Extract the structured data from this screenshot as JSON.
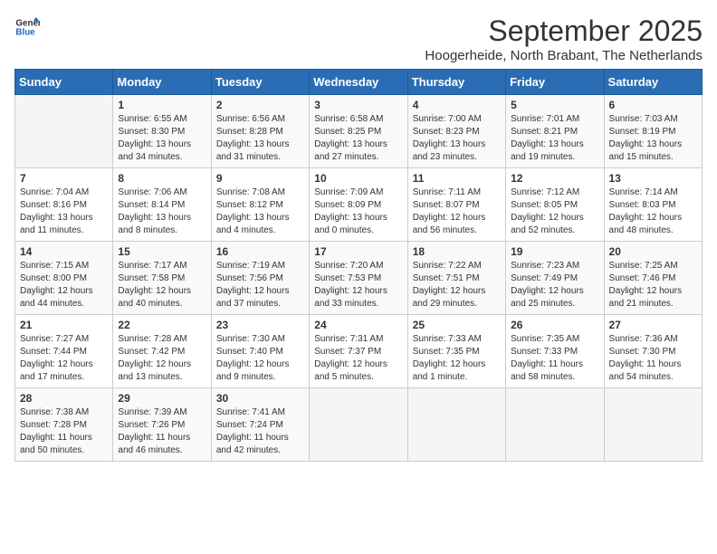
{
  "header": {
    "logo_general": "General",
    "logo_blue": "Blue",
    "month_title": "September 2025",
    "location": "Hoogerheide, North Brabant, The Netherlands"
  },
  "days_of_week": [
    "Sunday",
    "Monday",
    "Tuesday",
    "Wednesday",
    "Thursday",
    "Friday",
    "Saturday"
  ],
  "weeks": [
    [
      {
        "day": "",
        "info": ""
      },
      {
        "day": "1",
        "info": "Sunrise: 6:55 AM\nSunset: 8:30 PM\nDaylight: 13 hours and 34 minutes."
      },
      {
        "day": "2",
        "info": "Sunrise: 6:56 AM\nSunset: 8:28 PM\nDaylight: 13 hours and 31 minutes."
      },
      {
        "day": "3",
        "info": "Sunrise: 6:58 AM\nSunset: 8:25 PM\nDaylight: 13 hours and 27 minutes."
      },
      {
        "day": "4",
        "info": "Sunrise: 7:00 AM\nSunset: 8:23 PM\nDaylight: 13 hours and 23 minutes."
      },
      {
        "day": "5",
        "info": "Sunrise: 7:01 AM\nSunset: 8:21 PM\nDaylight: 13 hours and 19 minutes."
      },
      {
        "day": "6",
        "info": "Sunrise: 7:03 AM\nSunset: 8:19 PM\nDaylight: 13 hours and 15 minutes."
      }
    ],
    [
      {
        "day": "7",
        "info": "Sunrise: 7:04 AM\nSunset: 8:16 PM\nDaylight: 13 hours and 11 minutes."
      },
      {
        "day": "8",
        "info": "Sunrise: 7:06 AM\nSunset: 8:14 PM\nDaylight: 13 hours and 8 minutes."
      },
      {
        "day": "9",
        "info": "Sunrise: 7:08 AM\nSunset: 8:12 PM\nDaylight: 13 hours and 4 minutes."
      },
      {
        "day": "10",
        "info": "Sunrise: 7:09 AM\nSunset: 8:09 PM\nDaylight: 13 hours and 0 minutes."
      },
      {
        "day": "11",
        "info": "Sunrise: 7:11 AM\nSunset: 8:07 PM\nDaylight: 12 hours and 56 minutes."
      },
      {
        "day": "12",
        "info": "Sunrise: 7:12 AM\nSunset: 8:05 PM\nDaylight: 12 hours and 52 minutes."
      },
      {
        "day": "13",
        "info": "Sunrise: 7:14 AM\nSunset: 8:03 PM\nDaylight: 12 hours and 48 minutes."
      }
    ],
    [
      {
        "day": "14",
        "info": "Sunrise: 7:15 AM\nSunset: 8:00 PM\nDaylight: 12 hours and 44 minutes."
      },
      {
        "day": "15",
        "info": "Sunrise: 7:17 AM\nSunset: 7:58 PM\nDaylight: 12 hours and 40 minutes."
      },
      {
        "day": "16",
        "info": "Sunrise: 7:19 AM\nSunset: 7:56 PM\nDaylight: 12 hours and 37 minutes."
      },
      {
        "day": "17",
        "info": "Sunrise: 7:20 AM\nSunset: 7:53 PM\nDaylight: 12 hours and 33 minutes."
      },
      {
        "day": "18",
        "info": "Sunrise: 7:22 AM\nSunset: 7:51 PM\nDaylight: 12 hours and 29 minutes."
      },
      {
        "day": "19",
        "info": "Sunrise: 7:23 AM\nSunset: 7:49 PM\nDaylight: 12 hours and 25 minutes."
      },
      {
        "day": "20",
        "info": "Sunrise: 7:25 AM\nSunset: 7:46 PM\nDaylight: 12 hours and 21 minutes."
      }
    ],
    [
      {
        "day": "21",
        "info": "Sunrise: 7:27 AM\nSunset: 7:44 PM\nDaylight: 12 hours and 17 minutes."
      },
      {
        "day": "22",
        "info": "Sunrise: 7:28 AM\nSunset: 7:42 PM\nDaylight: 12 hours and 13 minutes."
      },
      {
        "day": "23",
        "info": "Sunrise: 7:30 AM\nSunset: 7:40 PM\nDaylight: 12 hours and 9 minutes."
      },
      {
        "day": "24",
        "info": "Sunrise: 7:31 AM\nSunset: 7:37 PM\nDaylight: 12 hours and 5 minutes."
      },
      {
        "day": "25",
        "info": "Sunrise: 7:33 AM\nSunset: 7:35 PM\nDaylight: 12 hours and 1 minute."
      },
      {
        "day": "26",
        "info": "Sunrise: 7:35 AM\nSunset: 7:33 PM\nDaylight: 11 hours and 58 minutes."
      },
      {
        "day": "27",
        "info": "Sunrise: 7:36 AM\nSunset: 7:30 PM\nDaylight: 11 hours and 54 minutes."
      }
    ],
    [
      {
        "day": "28",
        "info": "Sunrise: 7:38 AM\nSunset: 7:28 PM\nDaylight: 11 hours and 50 minutes."
      },
      {
        "day": "29",
        "info": "Sunrise: 7:39 AM\nSunset: 7:26 PM\nDaylight: 11 hours and 46 minutes."
      },
      {
        "day": "30",
        "info": "Sunrise: 7:41 AM\nSunset: 7:24 PM\nDaylight: 11 hours and 42 minutes."
      },
      {
        "day": "",
        "info": ""
      },
      {
        "day": "",
        "info": ""
      },
      {
        "day": "",
        "info": ""
      },
      {
        "day": "",
        "info": ""
      }
    ]
  ]
}
